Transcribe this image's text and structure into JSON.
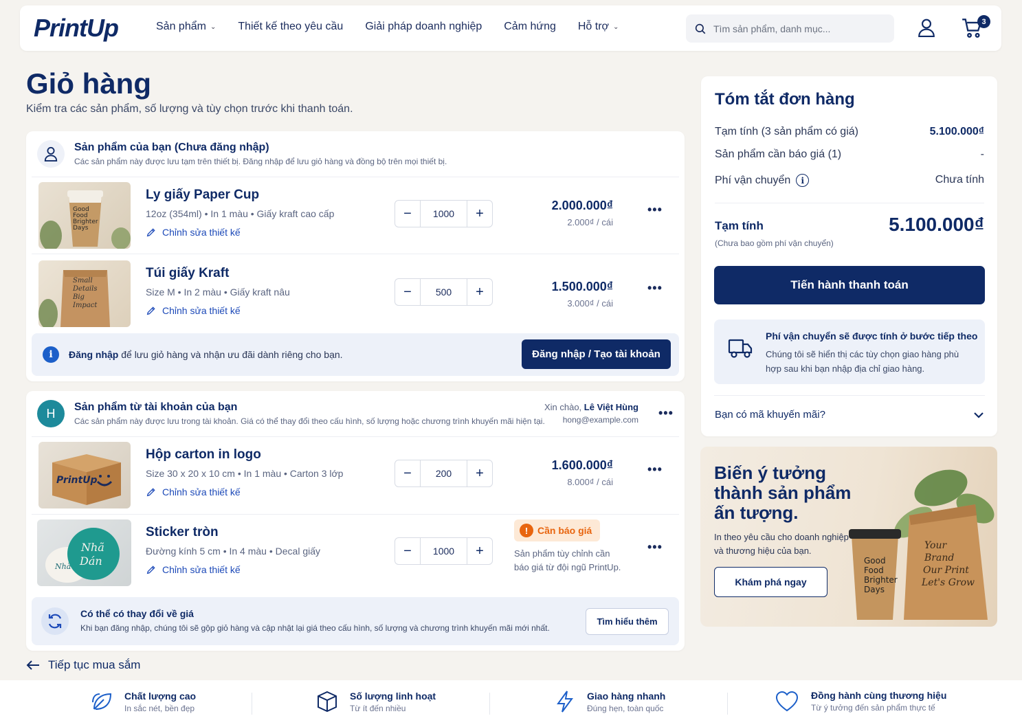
{
  "header": {
    "logo": "PrintUp",
    "nav": [
      {
        "label": "Sản phẩm",
        "has_dropdown": true
      },
      {
        "label": "Thiết kế theo yêu cầu",
        "has_dropdown": false
      },
      {
        "label": "Giải pháp doanh nghiệp",
        "has_dropdown": false
      },
      {
        "label": "Cảm hứng",
        "has_dropdown": false
      },
      {
        "label": "Hỗ trợ",
        "has_dropdown": true
      }
    ],
    "search_placeholder": "Tìm sản phẩm, danh mục...",
    "cart_count": "3"
  },
  "page": {
    "title": "Giỏ hàng",
    "subtitle": "Kiểm tra các sản phẩm, số lượng và tùy chọn trước khi thanh toán."
  },
  "guest_section": {
    "title": "Sản phẩm của bạn (Chưa đăng nhập)",
    "desc": "Các sản phẩm này được lưu tạm trên thiết bị. Đăng nhập để lưu giỏ hàng và đồng bộ trên mọi thiết bị.",
    "items": [
      {
        "name": "Ly giấy Paper Cup",
        "spec": "12oz (354ml) • In 1 màu • Giấy kraft cao cấp",
        "edit": "Chỉnh sửa thiết kế",
        "qty": "1000",
        "total": "2.000.000₫",
        "unit": "2.000₫ / cái"
      },
      {
        "name": "Túi giấy Kraft",
        "spec": "Size M • In 2 màu • Giấy kraft nâu",
        "edit": "Chỉnh sửa thiết kế",
        "qty": "500",
        "total": "1.500.000₫",
        "unit": "3.000₫ / cái"
      }
    ],
    "banner_bold": "Đăng nhập",
    "banner_text": " để lưu giỏ hàng và nhận ưu đãi dành riêng cho bạn.",
    "banner_button": "Đăng nhập / Tạo tài khoản"
  },
  "account_section": {
    "avatar_letter": "H",
    "title": "Sản phẩm từ tài khoản của bạn",
    "desc": "Các sản phẩm này được lưu trong tài khoản. Giá có thể thay đổi theo cấu hình, số lượng hoặc chương trình khuyến mãi hiện tại.",
    "greeting": "Xin chào, ",
    "user_name": "Lê Việt Hùng",
    "user_email": "hong@example.com",
    "items": [
      {
        "name": "Hộp carton in logo",
        "spec": "Size 30 x 20 x 10 cm • In 1 màu • Carton 3 lớp",
        "edit": "Chỉnh sửa thiết kế",
        "qty": "200",
        "total": "1.600.000₫",
        "unit": "8.000₫ / cái"
      },
      {
        "name": "Sticker tròn",
        "spec": "Đường kính 5 cm • In 4 màu • Decal giấy",
        "edit": "Chỉnh sửa thiết kế",
        "qty": "1000",
        "quote_badge": "Cần báo giá",
        "quote_note_1": "Sản phẩm tùy chỉnh cần",
        "quote_note_2": "báo giá từ đội ngũ PrintUp."
      }
    ],
    "banner_title": "Có thể có thay đổi về giá",
    "banner_text": "Khi bạn đăng nhập, chúng tôi sẽ gộp giỏ hàng và cập nhật lại giá theo cấu hình, số lượng và chương trình khuyến mãi mới nhất.",
    "banner_button": "Tìm hiểu thêm"
  },
  "continue_link": "Tiếp tục mua sắm",
  "summary": {
    "title": "Tóm tắt đơn hàng",
    "subtotal_label": "Tạm tính (3 sản phẩm có giá)",
    "subtotal_value": "5.100.000₫",
    "quote_label": "Sản phẩm cần báo giá (1)",
    "quote_value": "-",
    "shipping_label": "Phí vận chuyển",
    "shipping_value": "Chưa tính",
    "total_label": "Tạm tính",
    "total_note": "(Chưa bao gồm phí vận chuyển)",
    "total_value": "5.100.000₫",
    "checkout_button": "Tiến hành thanh toán",
    "ship_title": "Phí vận chuyển sẽ được tính ở bước tiếp theo",
    "ship_text_1": "Chúng tôi sẽ hiển thị các tùy chọn giao hàng phù",
    "ship_text_2": "hợp sau khi bạn nhập địa chỉ giao hàng.",
    "promo_label": "Bạn có mã khuyến mãi?"
  },
  "promo_banner": {
    "line1": "Biến ý tưởng",
    "line2": "thành sản phẩm",
    "line3": "ấn tượng.",
    "sub1": "In theo yêu cầu cho doanh nghiệp",
    "sub2": "và thương hiệu của bạn.",
    "button": "Khám phá ngay"
  },
  "footer": [
    {
      "title": "Chất lượng cao",
      "sub": "In sắc nét, bền đẹp",
      "icon": "leaf-icon"
    },
    {
      "title": "Số lượng linh hoạt",
      "sub": "Từ ít đến nhiều",
      "icon": "box-icon"
    },
    {
      "title": "Giao hàng nhanh",
      "sub": "Đúng hẹn, toàn quốc",
      "icon": "lightning-icon"
    },
    {
      "title": "Đồng hành cùng thương hiệu",
      "sub": "Từ ý tưởng đến sản phẩm thực tế",
      "icon": "heart-icon"
    }
  ],
  "colors": {
    "navy": "#0f2a66",
    "link_blue": "#1c49b8",
    "teal": "#1d8a9b",
    "orange": "#e8650f",
    "background": "#f5f3ef"
  }
}
